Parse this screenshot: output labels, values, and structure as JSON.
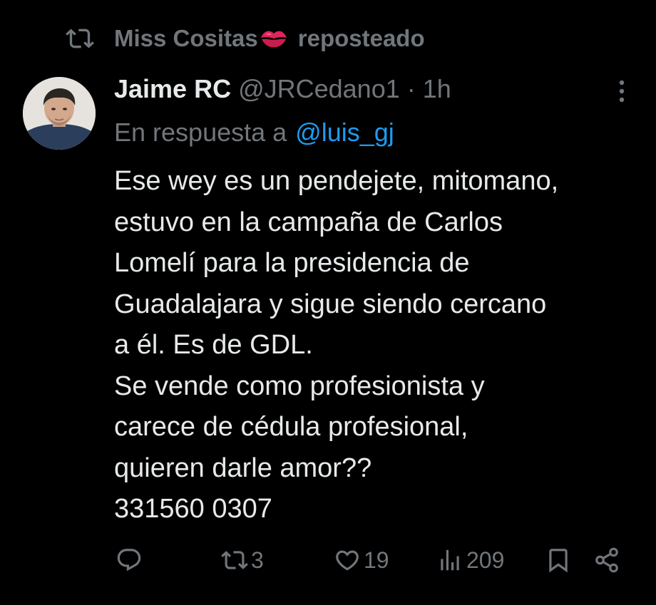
{
  "repost_banner": {
    "icon": "repost-icon",
    "name": "Miss Cositas",
    "emoji_icon": "kiss-mark-icon",
    "label": "reposteado"
  },
  "tweet": {
    "author": {
      "display_name": "Jaime RC",
      "handle": "@JRCedano1",
      "avatar": "profile-photo"
    },
    "separator": "·",
    "time": "1h",
    "reply_prefix": "En respuesta a",
    "reply_mention": "@luis_gj",
    "text_lines": [
      "Ese wey es un pendejete, mitomano,",
      "estuvo en la campaña de Carlos",
      "Lomelí para la presidencia de",
      "Guadalajara y sigue siendo cercano",
      "a él. Es de GDL.",
      "Se vende como profesionista y",
      "carece de cédula profesional,",
      "quieren darle amor??",
      "331560 0307"
    ]
  },
  "actions": {
    "reply": {
      "icon": "reply-icon",
      "count": ""
    },
    "repost": {
      "icon": "repost-icon",
      "count": "3"
    },
    "like": {
      "icon": "heart-icon",
      "count": "19"
    },
    "views": {
      "icon": "views-icon",
      "count": "209"
    },
    "bookmark": {
      "icon": "bookmark-icon"
    },
    "share": {
      "icon": "share-icon"
    }
  },
  "colors": {
    "background": "#000000",
    "text": "#e7e9ea",
    "muted": "#71767b",
    "link": "#1d9bf0",
    "kiss": "#e0245e"
  }
}
